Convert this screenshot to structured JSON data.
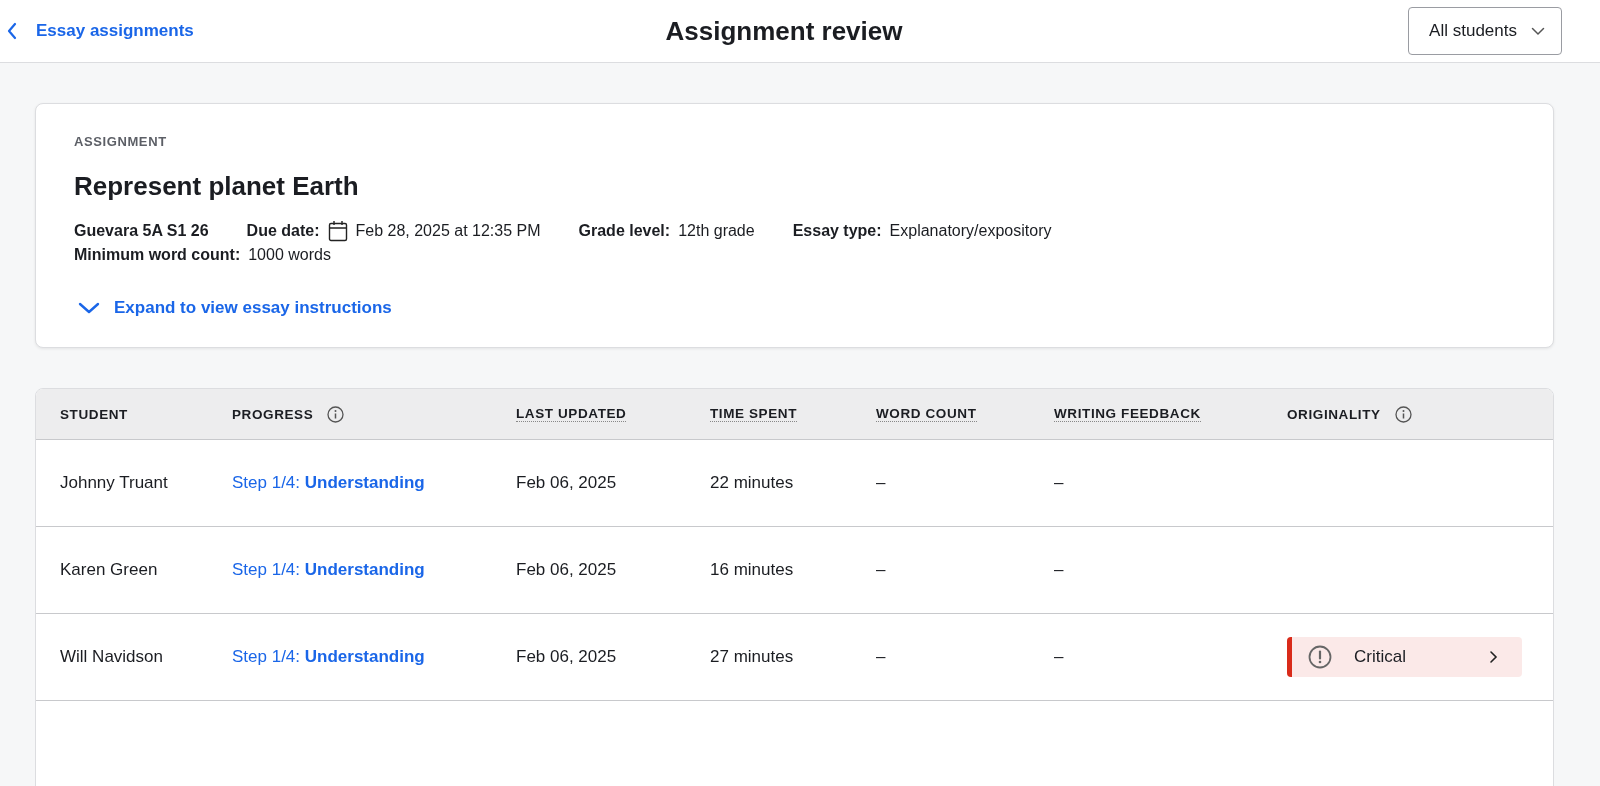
{
  "header": {
    "back_link": "Essay assignments",
    "title": "Assignment review",
    "filter": {
      "value": "All students"
    }
  },
  "assignment": {
    "eyebrow": "ASSIGNMENT",
    "title": "Represent planet Earth",
    "meta": [
      {
        "kind": "plain",
        "value": "Guevara 5A S1 26"
      },
      {
        "kind": "date",
        "label": "Due date:",
        "value": "Feb 28, 2025 at 12:35 PM"
      },
      {
        "kind": "field",
        "label": "Grade level:",
        "value": "12th grade"
      },
      {
        "kind": "field",
        "label": "Essay type:",
        "value": "Explanatory/expository"
      },
      {
        "kind": "field",
        "label": "Minimum word count:",
        "value": "1000 words"
      }
    ],
    "expand_link": "Expand to view essay instructions"
  },
  "table": {
    "columns": [
      {
        "label": "STUDENT",
        "kind": "plain"
      },
      {
        "label": "PROGRESS",
        "kind": "info"
      },
      {
        "label": "LAST UPDATED",
        "kind": "dotted"
      },
      {
        "label": "TIME SPENT",
        "kind": "dotted"
      },
      {
        "label": "WORD COUNT",
        "kind": "dotted"
      },
      {
        "label": "WRITING FEEDBACK",
        "kind": "dotted"
      },
      {
        "label": "ORIGINALITY",
        "kind": "info"
      }
    ],
    "rows": [
      {
        "student": "Johnny Truant",
        "progress": "Step 1/4: **Understanding**",
        "last_updated": "Feb 06, 2025",
        "time_spent": "22 minutes",
        "word_count": "–",
        "writing_feedback": "–"
      },
      {
        "student": "Karen Green",
        "progress": "Step 1/4: **Understanding**",
        "last_updated": "Feb 06, 2025",
        "time_spent": "16 minutes",
        "word_count": "–",
        "writing_feedback": "–"
      },
      {
        "student": "Will Navidson",
        "progress": "Step 1/4: **Understanding**",
        "last_updated": "Feb 06, 2025",
        "time_spent": "27 minutes",
        "word_count": "–",
        "writing_feedback": "–",
        "originality": {
          "label": "Critical",
          "color": "#d92b1a"
        }
      }
    ]
  }
}
